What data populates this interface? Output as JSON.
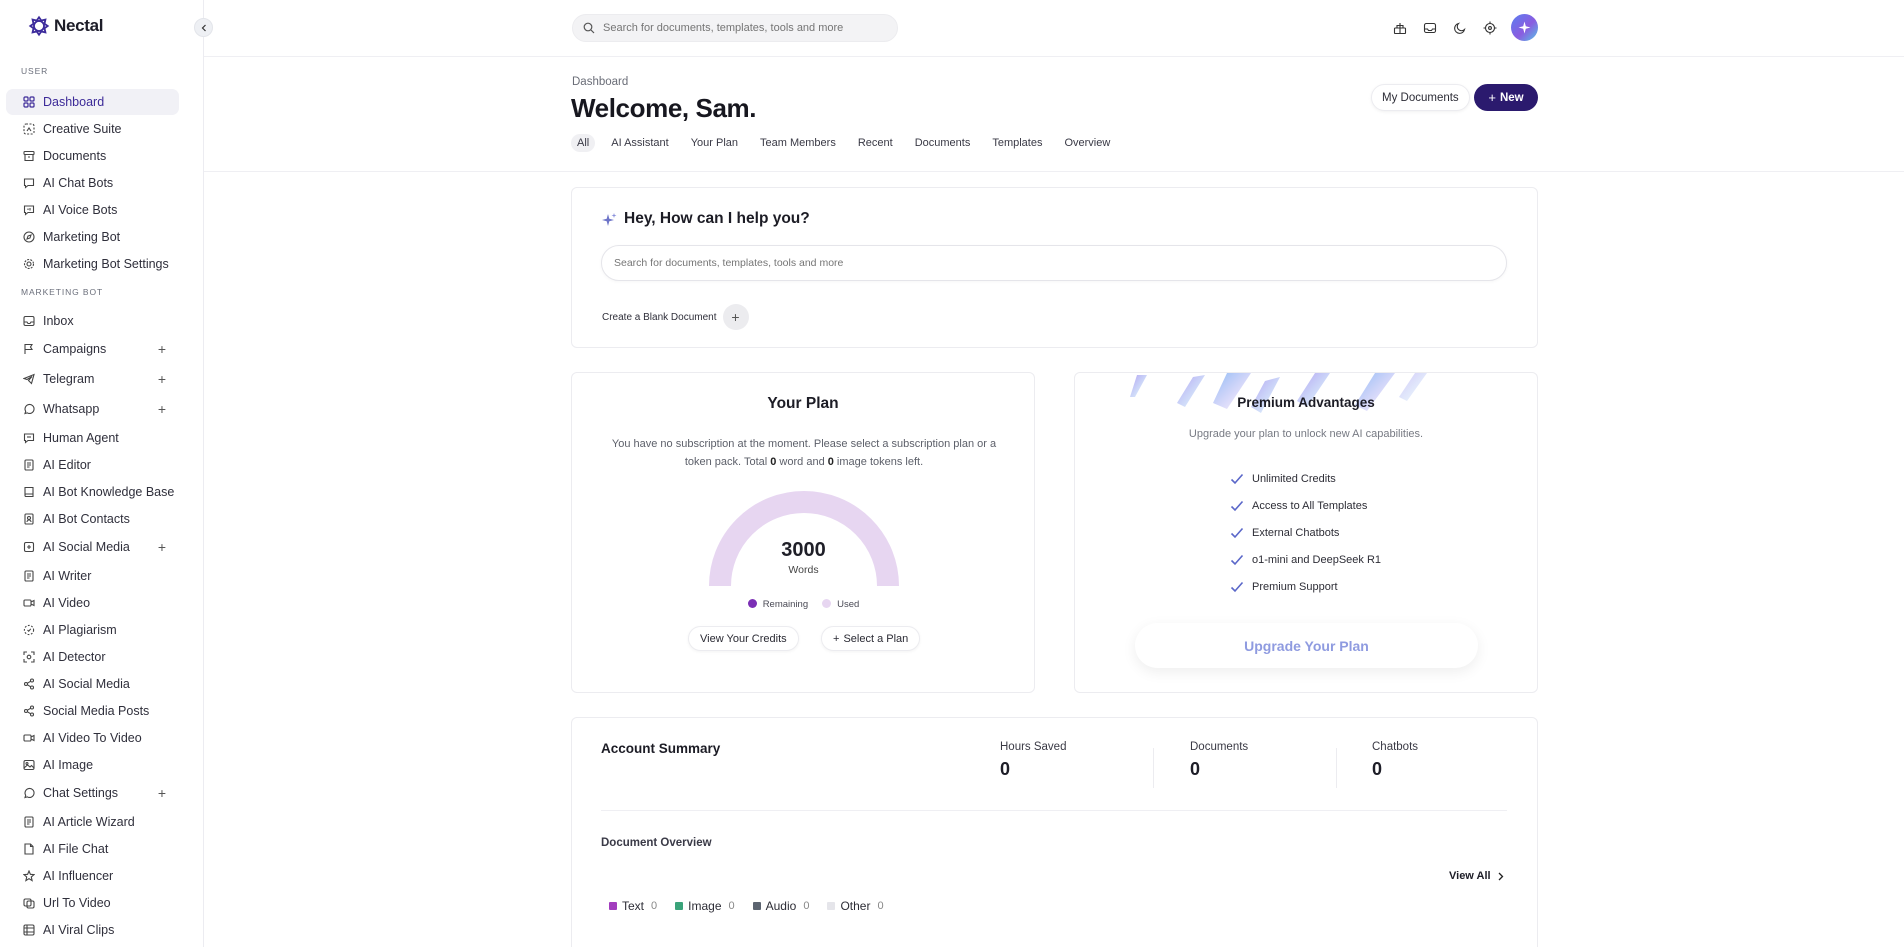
{
  "app": {
    "name": "Nectal"
  },
  "search": {
    "placeholder": "Search for documents, templates, tools and more"
  },
  "sidebar": {
    "sections": {
      "user": "USER",
      "marketing": "MARKETING BOT"
    },
    "user_items": [
      {
        "label": "Dashboard",
        "icon": "grid-icon"
      },
      {
        "label": "Creative Suite",
        "icon": "sparkle-image-icon"
      },
      {
        "label": "Documents",
        "icon": "archive-icon"
      },
      {
        "label": "AI Chat Bots",
        "icon": "chat-icon"
      },
      {
        "label": "AI Voice Bots",
        "icon": "voice-chat-icon"
      },
      {
        "label": "Marketing Bot",
        "icon": "compass-icon"
      },
      {
        "label": "Marketing Bot Settings",
        "icon": "gear-icon"
      }
    ],
    "marketing_items": [
      {
        "label": "Inbox",
        "icon": "inbox-icon"
      },
      {
        "label": "Campaigns",
        "icon": "flag-icon"
      },
      {
        "label": "Telegram",
        "icon": "telegram-icon"
      },
      {
        "label": "Whatsapp",
        "icon": "whatsapp-icon"
      },
      {
        "label": "Human Agent",
        "icon": "chat-icon"
      },
      {
        "label": "AI Editor",
        "icon": "document-icon"
      },
      {
        "label": "AI Bot Knowledge Base",
        "icon": "book-icon"
      },
      {
        "label": "AI Bot Contacts",
        "icon": "contacts-icon"
      },
      {
        "label": "AI Social Media",
        "icon": "share-icon"
      },
      {
        "label": "AI Writer",
        "icon": "document-icon"
      },
      {
        "label": "AI Video",
        "icon": "video-icon"
      },
      {
        "label": "AI Plagiarism",
        "icon": "dashed-circle-icon"
      },
      {
        "label": "AI Detector",
        "icon": "scan-icon"
      },
      {
        "label": "AI Social Media",
        "icon": "share-icon"
      },
      {
        "label": "Social Media Posts",
        "icon": "share-icon"
      },
      {
        "label": "AI Video To Video",
        "icon": "video-icon"
      },
      {
        "label": "AI Image",
        "icon": "image-icon"
      },
      {
        "label": "Chat Settings",
        "icon": "chat-bubble-icon"
      },
      {
        "label": "AI Article Wizard",
        "icon": "document-icon"
      },
      {
        "label": "AI File Chat",
        "icon": "file-chat-icon"
      },
      {
        "label": "AI Influencer",
        "icon": "star-icon"
      },
      {
        "label": "Url To Video",
        "icon": "link-video-icon"
      },
      {
        "label": "AI Viral Clips",
        "icon": "clips-icon"
      }
    ]
  },
  "header": {
    "breadcrumb": "Dashboard",
    "title": "Welcome, Sam.",
    "my_documents": "My Documents",
    "new_label": "New"
  },
  "tabs": [
    "All",
    "AI Assistant",
    "Your Plan",
    "Team Members",
    "Recent",
    "Documents",
    "Templates",
    "Overview"
  ],
  "help": {
    "title": "Hey, How can I help you?",
    "input_placeholder": "Search for documents, templates, tools and more",
    "blank_doc": "Create a Blank Document"
  },
  "plan": {
    "title": "Your Plan",
    "desc_1": "You have no subscription at the moment. Please select a subscription plan or a token pack. Total ",
    "word_tokens": "0",
    "desc_2": " word and ",
    "image_tokens": "0",
    "desc_3": " image tokens left.",
    "gauge_value": "3000",
    "gauge_unit": "Words",
    "remaining_fraction": 0,
    "legend_remaining": "Remaining",
    "legend_used": "Used",
    "view_credits": "View Your Credits",
    "select_plan": "Select a Plan",
    "colors": {
      "remaining": "#7b2fb5",
      "used": "#e7d6f1"
    }
  },
  "premium": {
    "title": "Premium Advantages",
    "subtitle": "Upgrade your plan to unlock new AI capabilities.",
    "features": [
      "Unlimited Credits",
      "Access to All Templates",
      "External Chatbots",
      "o1-mini and DeepSeek R1",
      "Premium Support"
    ],
    "upgrade": "Upgrade Your Plan"
  },
  "account": {
    "title": "Account Summary",
    "stats": [
      {
        "label": "Hours Saved",
        "value": "0"
      },
      {
        "label": "Documents",
        "value": "0"
      },
      {
        "label": "Chatbots",
        "value": "0"
      }
    ],
    "overview_title": "Document Overview",
    "view_all": "View All",
    "legend": [
      {
        "label": "Text",
        "count": "0",
        "color": "#a23dbe"
      },
      {
        "label": "Image",
        "count": "0",
        "color": "#3aa37a"
      },
      {
        "label": "Audio",
        "count": "0",
        "color": "#5c6470"
      },
      {
        "label": "Other",
        "count": "0",
        "color": "#e5e5ea"
      }
    ]
  },
  "colors": {
    "brand": "#2b1a6e",
    "accent": "#3c2a98"
  }
}
